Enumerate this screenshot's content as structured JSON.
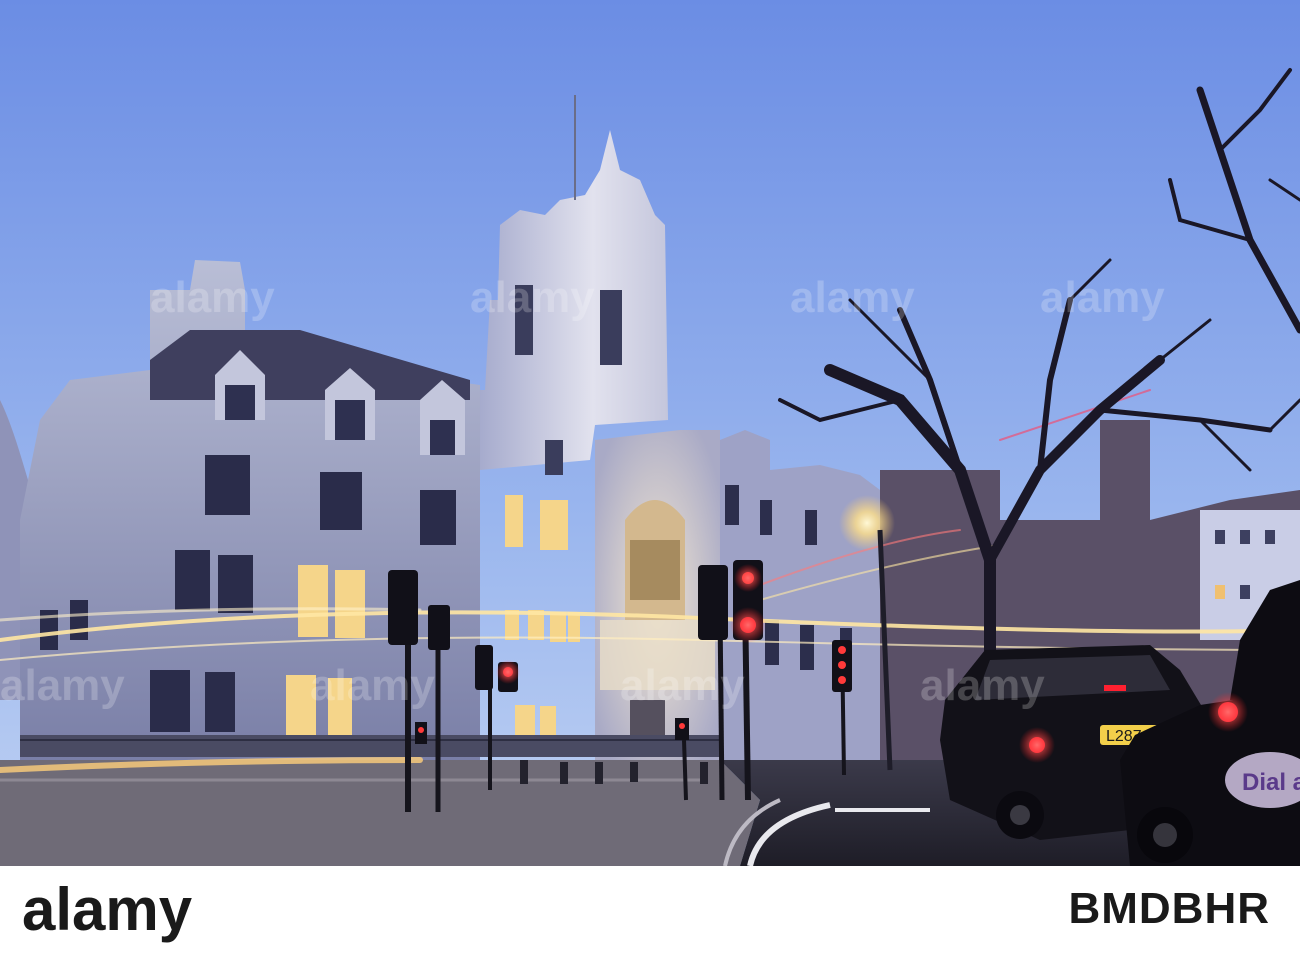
{
  "brand": {
    "name": "alamy"
  },
  "image_id": "BMDBHR",
  "watermark": {
    "text": "alamy"
  },
  "taxi_plate": "L287",
  "taxi_ad": "Dial a",
  "colors": {
    "sky_top": "#6d8fe6",
    "sky_bottom": "#b7cdf2",
    "road": "#2b2a36",
    "light_trail": "#ffe7a3"
  }
}
